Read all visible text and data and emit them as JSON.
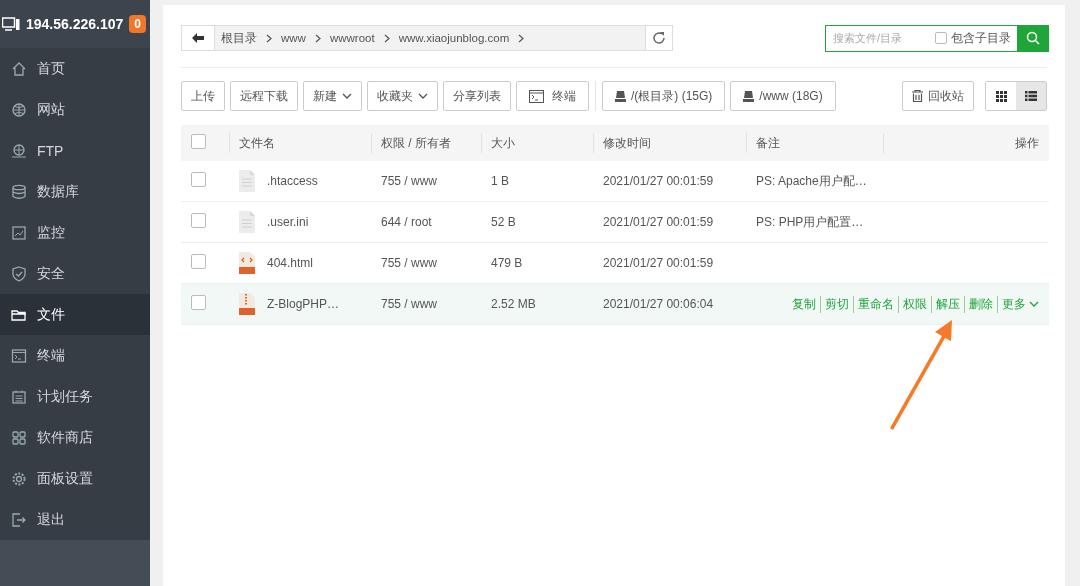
{
  "sidebar": {
    "host": "194.56.226.107",
    "badge": "0",
    "items": [
      {
        "label": "首页",
        "selected": false
      },
      {
        "label": "网站",
        "selected": false
      },
      {
        "label": "FTP",
        "selected": false
      },
      {
        "label": "数据库",
        "selected": false
      },
      {
        "label": "监控",
        "selected": false
      },
      {
        "label": "安全",
        "selected": false
      },
      {
        "label": "文件",
        "selected": true
      },
      {
        "label": "终端",
        "selected": false
      },
      {
        "label": "计划任务",
        "selected": false
      },
      {
        "label": "软件商店",
        "selected": false
      },
      {
        "label": "面板设置",
        "selected": false
      },
      {
        "label": "退出",
        "selected": false
      }
    ]
  },
  "breadcrumb": [
    "根目录",
    "www",
    "wwwroot",
    "www.xiaojunblog.com"
  ],
  "search": {
    "placeholder": "搜索文件/目录",
    "subdir_label": "包含子目录",
    "subdir_checked": false
  },
  "toolbar": [
    {
      "kind": "plain",
      "label": "上传"
    },
    {
      "kind": "plain",
      "label": "远程下载"
    },
    {
      "kind": "dropdown",
      "label": "新建"
    },
    {
      "kind": "dropdown",
      "label": "收藏夹"
    },
    {
      "kind": "plain",
      "label": "分享列表"
    },
    {
      "kind": "terminal",
      "label": "终端"
    },
    {
      "kind": "disk",
      "label": "/(根目录) (15G)"
    },
    {
      "kind": "disk",
      "label": "/www (18G)"
    }
  ],
  "recycle": "回收站",
  "views": [
    {
      "kind": "grid",
      "selected": false
    },
    {
      "kind": "list",
      "selected": true
    }
  ],
  "table": {
    "all_checked": false,
    "columns": [
      "文件名",
      "权限 / 所有者",
      "大小",
      "修改时间",
      "备注",
      "操作"
    ],
    "rows": [
      {
        "kind": "file",
        "name": ".htaccess",
        "perm": "755 / www",
        "size": "1 B",
        "mtime": "2021/01/27 00:01:59",
        "note": "PS: Apache用户配…",
        "checked": false,
        "selected": false
      },
      {
        "kind": "file",
        "name": ".user.ini",
        "perm": "644 / root",
        "size": "52 B",
        "mtime": "2021/01/27 00:01:59",
        "note": "PS: PHP用户配置…",
        "checked": false,
        "selected": false
      },
      {
        "kind": "html",
        "name": "404.html",
        "perm": "755 / www",
        "size": "479 B",
        "mtime": "2021/01/27 00:01:59",
        "checked": false,
        "selected": false
      },
      {
        "kind": "zip",
        "name": "Z-BlogPHP…",
        "perm": "755 / www",
        "size": "2.52 MB",
        "mtime": "2021/01/27 00:06:04",
        "checked": false,
        "selected": true,
        "actions": [
          "复制",
          "剪切",
          "重命名",
          "权限",
          "解压",
          "删除",
          "更多"
        ]
      }
    ]
  }
}
